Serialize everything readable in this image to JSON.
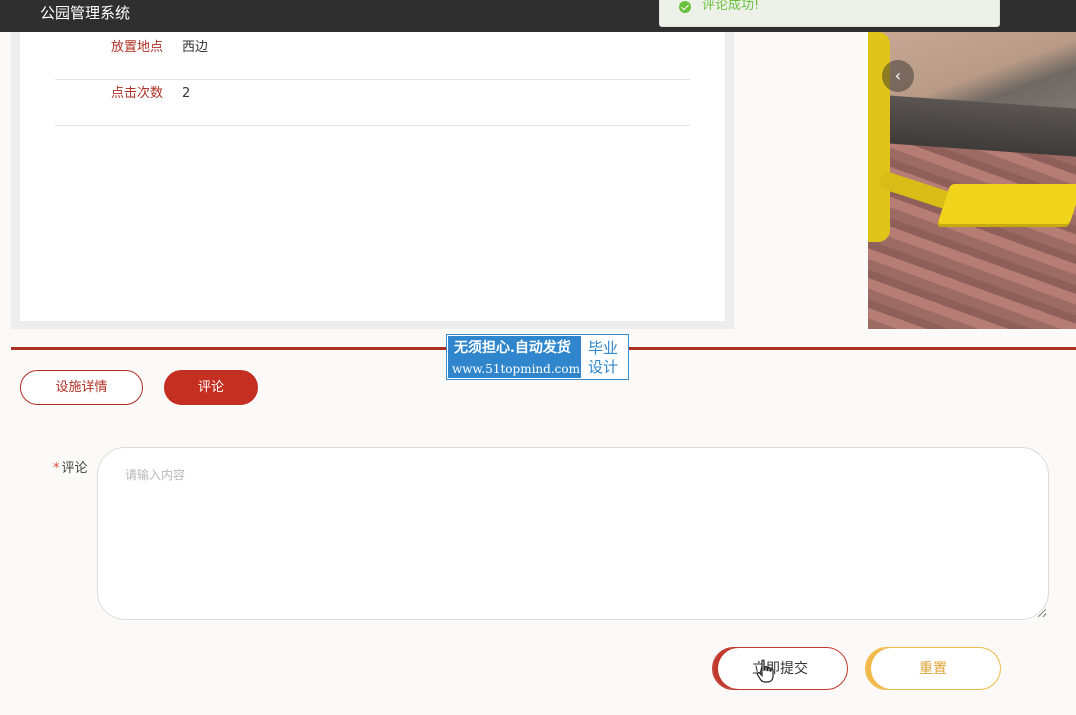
{
  "app": {
    "title": "公园管理系统"
  },
  "toast": {
    "message": "评论成功!",
    "icon": "check-circle-icon",
    "color": "#67c23a"
  },
  "detail": {
    "rows": [
      {
        "label": "放置地点",
        "value": "西边"
      },
      {
        "label": "点击次数",
        "value": "2"
      }
    ]
  },
  "carousel": {
    "prev_icon": "chevron-left-icon",
    "prev_glyph": "‹"
  },
  "watermark": {
    "line1": "无须担心.自动发货",
    "line2": "www.51topmind.com",
    "right": "毕业设计"
  },
  "tabs": [
    {
      "label": "设施详情",
      "active": false
    },
    {
      "label": "评论",
      "active": true
    }
  ],
  "form": {
    "required_mark": "*",
    "comment_label": "评论",
    "comment_placeholder": "请输入内容",
    "comment_value": ""
  },
  "buttons": {
    "submit": "立即提交",
    "reset": "重置"
  },
  "colors": {
    "brand": "#c42f22",
    "topbar": "#2f2f2f",
    "reset": "#f0b94a"
  }
}
